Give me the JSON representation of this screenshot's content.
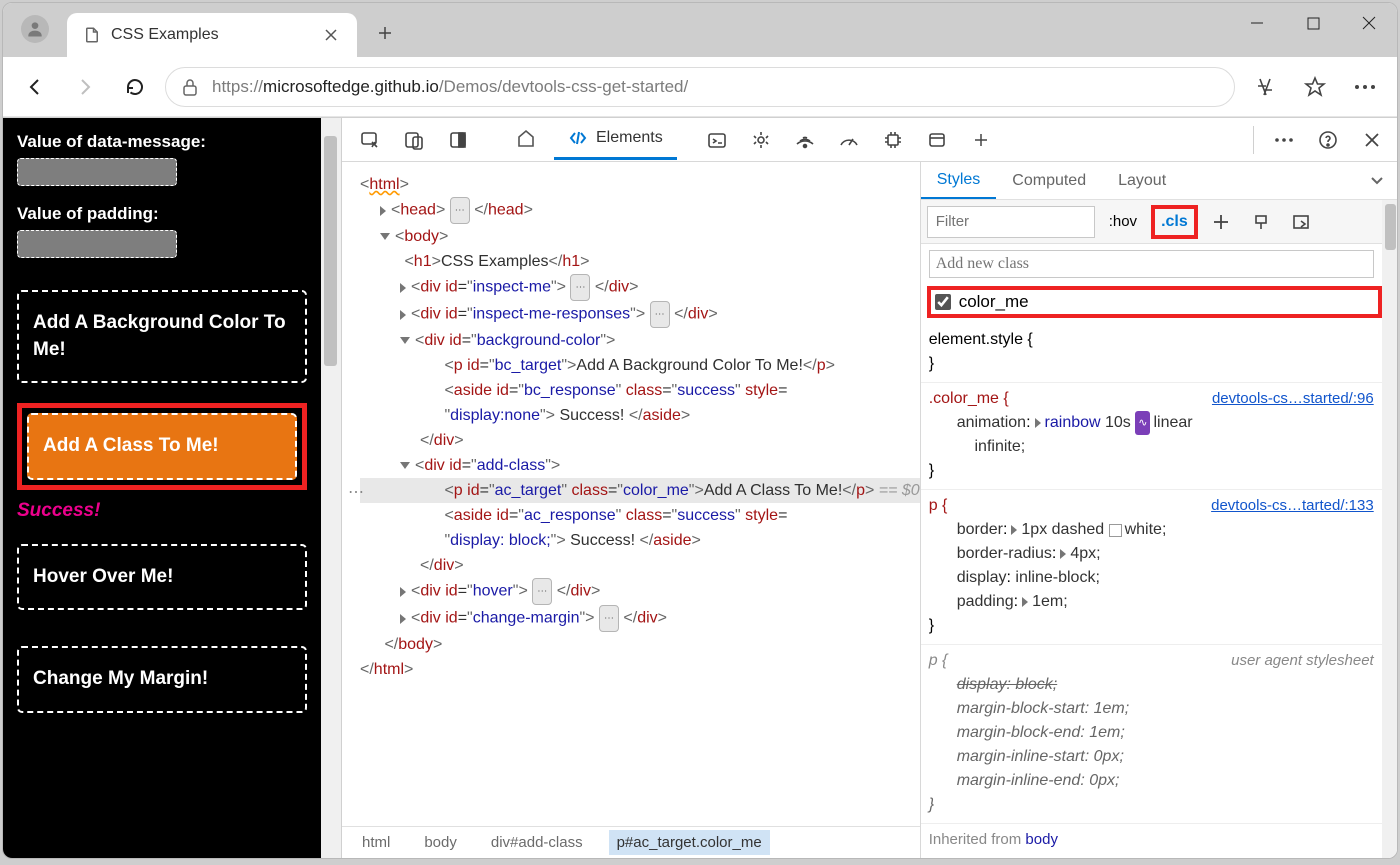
{
  "window": {
    "tab_title": "CSS Examples",
    "url_host": "microsoftedge.github.io",
    "url_scheme": "https://",
    "url_path": "/Demos/devtools-css-get-started/"
  },
  "page": {
    "lbl_data_message": "Value of data-message:",
    "lbl_padding": "Value of padding:",
    "box_bg": "Add A Background Color To Me!",
    "box_class": "Add A Class To Me!",
    "success": "Success!",
    "box_hover": "Hover Over Me!",
    "box_margin": "Change My Margin!"
  },
  "devtools": {
    "elements_label": "Elements",
    "breadcrumb": [
      "html",
      "body",
      "div#add-class",
      "p#ac_target.color_me"
    ],
    "dom": {
      "html_open": "<html>",
      "head": "<head>",
      "head_close": "</head>",
      "body_open": "<body>",
      "h1_open": "<h1>",
      "h1_text": "CSS Examples",
      "h1_close": "</h1>",
      "inspect_me": "inspect-me",
      "inspect_me_responses": "inspect-me-responses",
      "background_color": "background-color",
      "bc_target": "bc_target",
      "bc_text": "Add A Background Color To Me!",
      "p_close": "</p>",
      "bc_response": "bc_response",
      "success_class": "success",
      "style_none": "display:none",
      "success_text": " Success! ",
      "aside_close": "</aside>",
      "div_close": "</div>",
      "add_class": "add-class",
      "ac_target": "ac_target",
      "color_me": "color_me",
      "ac_text": "Add A Class To Me!",
      "eq0": " == $0",
      "ac_response": "ac_response",
      "style_block": "display: block;",
      "hover": "hover",
      "change_margin": "change-margin",
      "body_close": "</body>",
      "html_close": "</html>"
    }
  },
  "styles": {
    "tabs": {
      "styles": "Styles",
      "computed": "Computed",
      "layout": "Layout"
    },
    "filter_placeholder": "Filter",
    "hov": ":hov",
    "cls": ".cls",
    "add_class_placeholder": "Add new class",
    "color_me_label": "color_me",
    "element_style": "element.style {",
    "brace_close": "}",
    "rule1": {
      "sel": ".color_me {",
      "link": "devtools-cs…started/:96",
      "anim_name": "animation",
      "anim_val_rainbow": "rainbow",
      "anim_val_rest": " 10s ",
      "anim_val_linear": "linear",
      "anim_val_inf": "infinite;"
    },
    "rule2": {
      "sel": "p {",
      "link": "devtools-cs…tarted/:133",
      "border_n": "border",
      "border_v": "1px dashed ",
      "border_c": "white;",
      "br_n": "border-radius",
      "br_v": "4px;",
      "disp_n": "display",
      "disp_v": "inline-block;",
      "pad_n": "padding",
      "pad_v": "1em;"
    },
    "rule3": {
      "sel": "p {",
      "ua": "user agent stylesheet",
      "disp": "display: block;",
      "mbs_n": "margin-block-start",
      "mbs_v": "1em;",
      "mbe_n": "margin-block-end",
      "mbe_v": "1em;",
      "mis_n": "margin-inline-start",
      "mis_v": "0px;",
      "mie_n": "margin-inline-end",
      "mie_v": "0px;"
    },
    "inherited": "Inherited from ",
    "inherited_from": "body"
  }
}
